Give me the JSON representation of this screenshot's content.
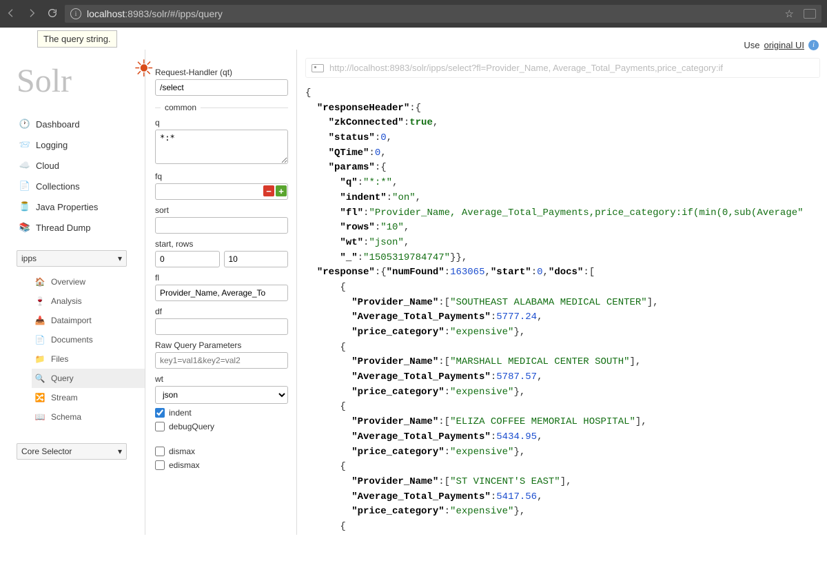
{
  "browser": {
    "url_host": "localhost",
    "url_port": ":8983",
    "url_path": "/solr/#/ipps/query"
  },
  "tooltip": "The query string.",
  "topright": {
    "prefix": "Use ",
    "link": "original UI"
  },
  "logo_text": "Solr",
  "nav": {
    "dashboard": "Dashboard",
    "logging": "Logging",
    "cloud": "Cloud",
    "collections": "Collections",
    "java_props": "Java Properties",
    "thread_dump": "Thread Dump"
  },
  "core_selected": "ipps",
  "subnav": {
    "overview": "Overview",
    "analysis": "Analysis",
    "dataimport": "Dataimport",
    "documents": "Documents",
    "files": "Files",
    "query": "Query",
    "stream": "Stream",
    "schema": "Schema"
  },
  "core_selector_label": "Core Selector",
  "query_form": {
    "qt_label": "Request-Handler (qt)",
    "qt_value": "/select",
    "common_label": "common",
    "q_label": "q",
    "q_value": "*:*",
    "fq_label": "fq",
    "sort_label": "sort",
    "startrows_label": "start, rows",
    "start_value": "0",
    "rows_value": "10",
    "fl_label": "fl",
    "fl_value": "Provider_Name, Average_To",
    "df_label": "df",
    "raw_label": "Raw Query Parameters",
    "raw_placeholder": "key1=val1&key2=val2",
    "wt_label": "wt",
    "wt_value": "json",
    "indent_label": "indent",
    "debug_label": "debugQuery",
    "dismax_label": "dismax",
    "edismax_label": "edismax"
  },
  "result_url": "http://localhost:8983/solr/ipps/select?fl=Provider_Name, Average_Total_Payments,price_category:if",
  "json": {
    "zkConnected": "true",
    "status": "0",
    "qtime": "0",
    "params_q": "*:*",
    "params_indent": "on",
    "params_fl": "Provider_Name, Average_Total_Payments,price_category:if(min(0,sub(Average",
    "params_rows": "10",
    "params_wt": "json",
    "params_underscore": "1505319784747",
    "numFound": "163065",
    "start": "0",
    "docs": [
      {
        "name": "SOUTHEAST ALABAMA MEDICAL CENTER",
        "avg": "5777.24",
        "cat": "expensive"
      },
      {
        "name": "MARSHALL MEDICAL CENTER SOUTH",
        "avg": "5787.57",
        "cat": "expensive"
      },
      {
        "name": "ELIZA COFFEE MEMORIAL HOSPITAL",
        "avg": "5434.95",
        "cat": "expensive"
      },
      {
        "name": "ST VINCENT'S EAST",
        "avg": "5417.56",
        "cat": "expensive"
      }
    ]
  }
}
